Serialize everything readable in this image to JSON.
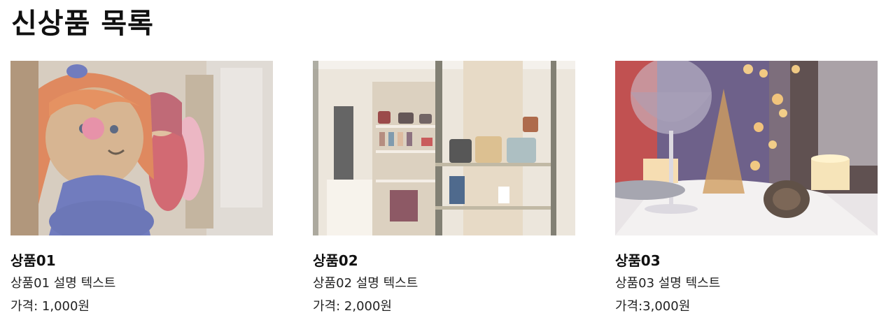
{
  "page": {
    "title": "신상품 목록"
  },
  "products": [
    {
      "name": "상품01",
      "description": "상품01 설명 텍스트",
      "price": "가격: 1,000원",
      "image_subject": "crochet-dolls-photo"
    },
    {
      "name": "상품02",
      "description": "상품02 설명 텍스트",
      "price": "가격: 2,000원",
      "image_subject": "handbag-store-interior-photo"
    },
    {
      "name": "상품03",
      "description": "상품03 설명 텍스트",
      "price": "가격:3,000원",
      "image_subject": "christmas-table-wineglass-photo"
    }
  ]
}
